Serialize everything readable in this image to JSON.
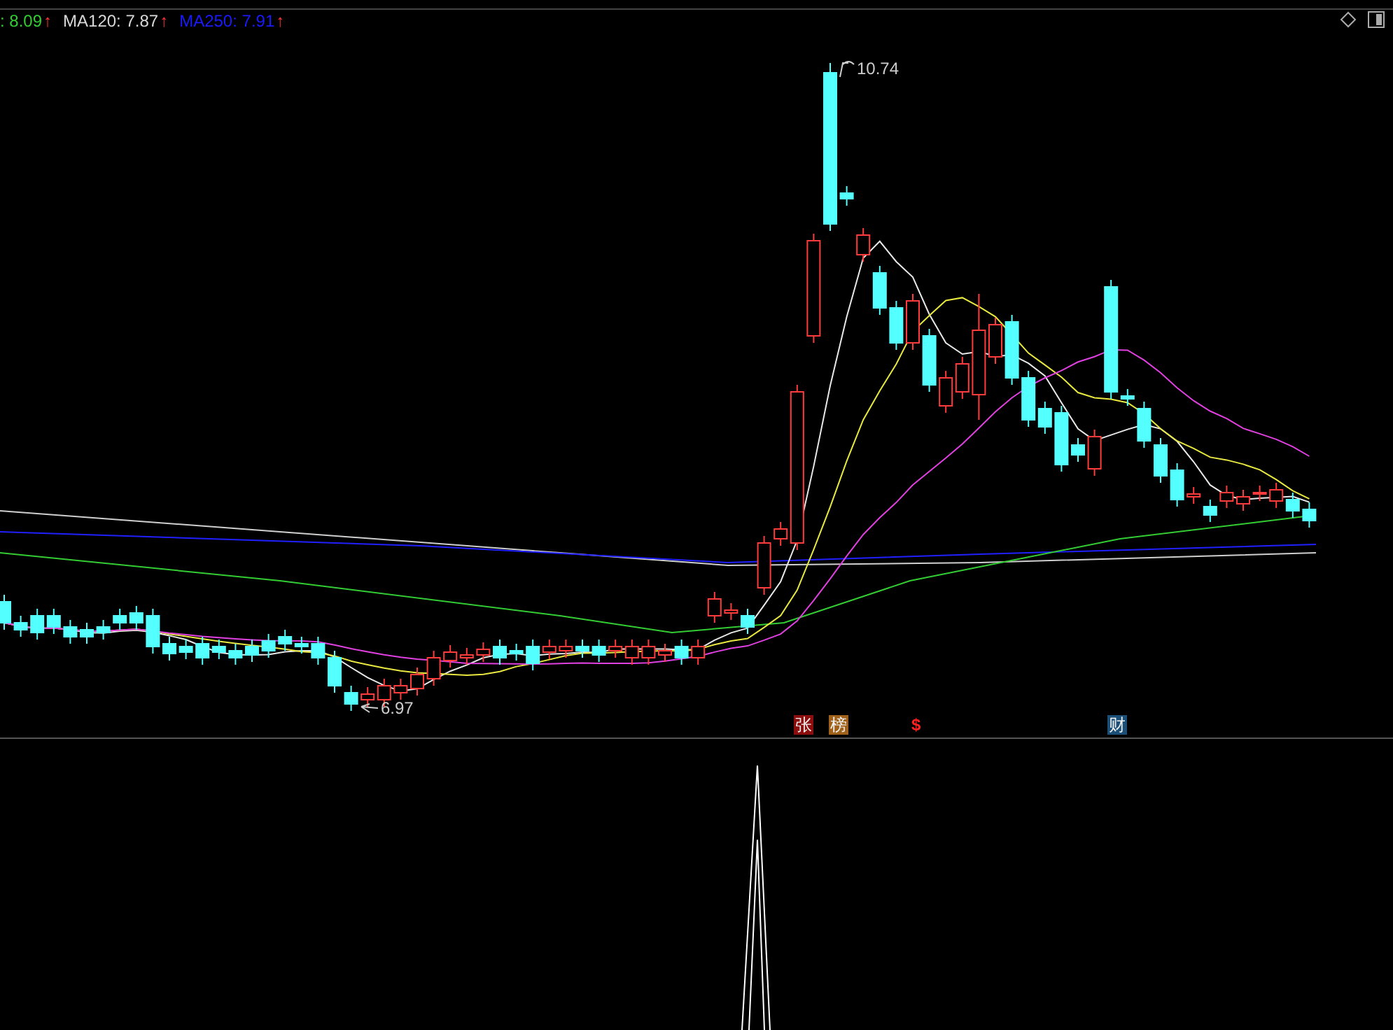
{
  "legend": [
    {
      "text": ": 8.09",
      "color": "#33cc33",
      "arrow": "↑"
    },
    {
      "text": "MA120: 7.87",
      "color": "#d8d8d8",
      "arrow": "↑"
    },
    {
      "text": "MA250: 7.91",
      "color": "#1a1aff",
      "arrow": "↑"
    }
  ],
  "price_labels": [
    {
      "text": "10.74",
      "kind": "high"
    },
    {
      "text": "6.97",
      "kind": "low"
    }
  ],
  "markers": [
    {
      "text": "张",
      "color": "#8b0d0d"
    },
    {
      "text": "榜",
      "color": "#a0621a"
    },
    {
      "text": "$",
      "color": "#000000"
    },
    {
      "text": "财",
      "color": "#1b4f77"
    }
  ]
}
